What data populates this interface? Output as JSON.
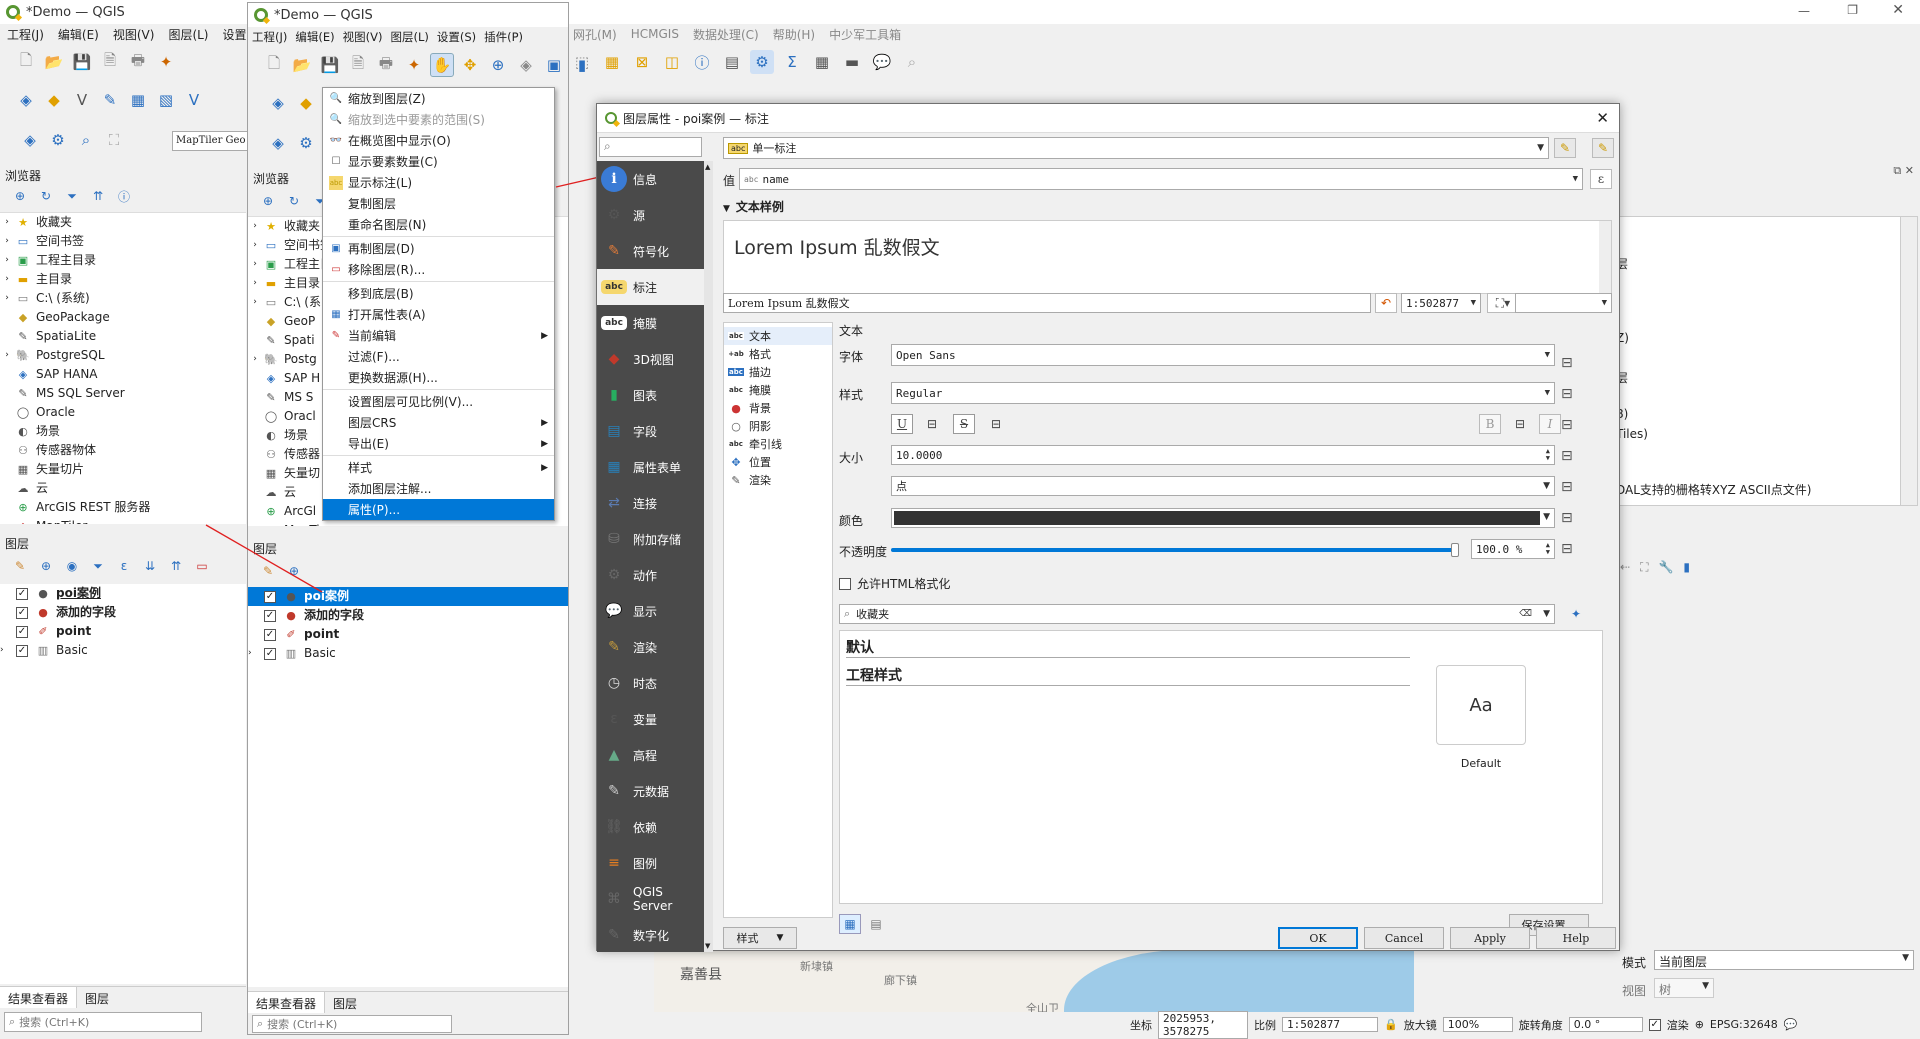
{
  "back_window": {
    "title": "*Demo — QGIS",
    "menu": [
      "工程(J)",
      "编辑(E)",
      "视图(V)",
      "图层(L)",
      "设置"
    ],
    "menu_rest": [
      "网孔(M)",
      "HCMGIS",
      "数据处理(C)",
      "帮助(H)",
      "中少军工具箱"
    ],
    "browser_title": "浏览器",
    "browser_items": [
      "收藏夹",
      "空间书签",
      "工程主目录",
      "主目录",
      "C:\\ (系统)",
      "GeoPackage",
      "SpatiaLite",
      "PostgreSQL",
      "SAP HANA",
      "MS SQL Server",
      "Oracle",
      "场景",
      "传感器物体",
      "矢量切片",
      "云",
      "ArcGIS REST 服务器",
      "MapTiler"
    ],
    "layers_title": "图层",
    "layers": [
      "poi案例",
      "添加的字段",
      "point",
      "Basic"
    ],
    "bottom_tabs": [
      "结果查看器",
      "图层"
    ],
    "search_placeholder": "搜索 (Ctrl+K)",
    "maptiler_label": "MapTiler Geo"
  },
  "front_window": {
    "title": "*Demo — QGIS",
    "menu": [
      "工程(J)",
      "编辑(E)",
      "视图(V)",
      "图层(L)",
      "设置(S)",
      "插件(P)"
    ],
    "browser_title": "浏览器",
    "browser_items": [
      "收藏夹",
      "空间书签",
      "工程主目录",
      "主目录",
      "C:\\ (系",
      "GeoP",
      "Spati",
      "Postg",
      "SAP H",
      "MS S",
      "Oracl",
      "场景",
      "传感器",
      "矢量切",
      "云",
      "ArcGl",
      "MapTi"
    ],
    "layers_title": "图层",
    "layers": [
      "poi案例",
      "添加的字段",
      "point",
      "Basic"
    ],
    "bottom_tabs": [
      "结果查看器",
      "图层"
    ],
    "search_placeholder": "搜索 (Ctrl+K)"
  },
  "context_menu": [
    {
      "label": "缩放到图层(Z)",
      "icon": "zoom-layer-icon"
    },
    {
      "label": "缩放到选中要素的范围(S)",
      "icon": "zoom-selection-icon",
      "disabled": true
    },
    {
      "label": "在概览图中显示(O)",
      "icon": "overview-icon"
    },
    {
      "label": "显示要素数量(C)",
      "icon": "checkbox-icon"
    },
    {
      "label": "显示标注(L)",
      "icon": "label-icon"
    },
    {
      "label": "复制图层",
      "icon": ""
    },
    {
      "label": "重命名图层(N)",
      "icon": ""
    },
    {
      "sep": true
    },
    {
      "label": "再制图层(D)",
      "icon": "duplicate-icon"
    },
    {
      "label": "移除图层(R)...",
      "icon": "remove-icon"
    },
    {
      "sep": true
    },
    {
      "label": "移到底层(B)",
      "icon": ""
    },
    {
      "label": "打开属性表(A)",
      "icon": "table-icon"
    },
    {
      "label": "当前编辑",
      "icon": "pencil-icon",
      "submenu": true
    },
    {
      "label": "过滤(F)...",
      "icon": ""
    },
    {
      "label": "更换数据源(H)...",
      "icon": ""
    },
    {
      "sep": true
    },
    {
      "label": "设置图层可见比例(V)...",
      "icon": ""
    },
    {
      "label": "图层CRS",
      "icon": "",
      "submenu": true
    },
    {
      "label": "导出(E)",
      "icon": "",
      "submenu": true
    },
    {
      "sep": true
    },
    {
      "label": "样式",
      "icon": "",
      "submenu": true
    },
    {
      "label": "添加图层注解...",
      "icon": ""
    },
    {
      "label": "属性(P)...",
      "icon": "",
      "selected": true
    }
  ],
  "dialog": {
    "title": "图层属性 - poi案例 — 标注",
    "mode": "单一标注",
    "value_label": "值",
    "value_field": "name",
    "section_title": "文本样例",
    "preview_text": "Lorem Ipsum 乱数假文",
    "preview_input": "Lorem Ipsum 乱数假文",
    "scale": "1:502877",
    "side_items": [
      {
        "label": "信息",
        "icon": "info-icon",
        "color": "#3a7bd5",
        "glyph": "i"
      },
      {
        "label": "源",
        "icon": "source-icon",
        "color": "#555",
        "glyph": "⚙"
      },
      {
        "label": "符号化",
        "icon": "symbology-icon",
        "color": "#e07b39",
        "glyph": "✎"
      },
      {
        "label": "标注",
        "icon": "labels-icon",
        "color": "#f5d76e",
        "glyph": "abc",
        "active": true
      },
      {
        "label": "掩膜",
        "icon": "mask-icon",
        "color": "#555",
        "glyph": "abc"
      },
      {
        "label": "3D视图",
        "icon": "3d-icon",
        "color": "#c0392b",
        "glyph": "◆"
      },
      {
        "label": "图表",
        "icon": "diagram-icon",
        "color": "#27ae60",
        "glyph": "▮"
      },
      {
        "label": "字段",
        "icon": "fields-icon",
        "color": "#2980b9",
        "glyph": "▤"
      },
      {
        "label": "属性表单",
        "icon": "form-icon",
        "color": "#2980b9",
        "glyph": "▦"
      },
      {
        "label": "连接",
        "icon": "join-icon",
        "color": "#5b7bb0",
        "glyph": "⇄"
      },
      {
        "label": "附加存储",
        "icon": "storage-icon",
        "color": "#777",
        "glyph": "⛁"
      },
      {
        "label": "动作",
        "icon": "action-icon",
        "color": "#666",
        "glyph": "⚙"
      },
      {
        "label": "显示",
        "icon": "display-icon",
        "color": "#f1c40f",
        "glyph": "💬"
      },
      {
        "label": "渲染",
        "icon": "render-icon",
        "color": "#c49a3c",
        "glyph": "✎"
      },
      {
        "label": "时态",
        "icon": "temporal-icon",
        "color": "#ddd",
        "glyph": "◷"
      },
      {
        "label": "变量",
        "icon": "variable-icon",
        "color": "#555",
        "glyph": "ε"
      },
      {
        "label": "高程",
        "icon": "elevation-icon",
        "color": "#6a8",
        "glyph": "▲"
      },
      {
        "label": "元数据",
        "icon": "metadata-icon",
        "color": "#ccc",
        "glyph": "✎"
      },
      {
        "label": "依赖",
        "icon": "dependency-icon",
        "color": "#666",
        "glyph": "⛓"
      },
      {
        "label": "图例",
        "icon": "legend-icon",
        "color": "#e67e22",
        "glyph": "≡"
      },
      {
        "label": "QGIS Server",
        "icon": "server-icon",
        "color": "#666",
        "glyph": "⌘"
      },
      {
        "label": "数字化",
        "icon": "digitize-icon",
        "color": "#666",
        "glyph": "✎"
      }
    ],
    "tabs": [
      {
        "label": "文本",
        "glyph": "abc"
      },
      {
        "label": "格式",
        "glyph": "+ab"
      },
      {
        "label": "描边",
        "glyph": "abc"
      },
      {
        "label": "掩膜",
        "glyph": "abc"
      },
      {
        "label": "背景",
        "glyph": "●"
      },
      {
        "label": "阴影",
        "glyph": "○"
      },
      {
        "label": "牵引线",
        "glyph": "abc"
      },
      {
        "label": "位置",
        "glyph": "✥"
      },
      {
        "label": "渲染",
        "glyph": "✎"
      }
    ],
    "text_section": "文本",
    "font_label": "字体",
    "font_value": "Open Sans",
    "style_label": "样式",
    "style_value": "Regular",
    "size_label": "大小",
    "size_value": "10.0000",
    "unit_value": "点",
    "color_label": "颜色",
    "color_value": "#333333",
    "opacity_label": "不透明度",
    "opacity_value": "100.0 %",
    "opacity_fraction": 1.0,
    "allow_html": "允许HTML格式化",
    "lib_search": "收藏夹",
    "lib_groups": [
      "默认",
      "工程样式"
    ],
    "lib_item": "Default",
    "lib_swatch": "Aa",
    "save_settings": "保存设置…",
    "style_button": "样式",
    "ok": "OK",
    "cancel": "Cancel",
    "apply": "Apply",
    "help": "Help"
  },
  "right_area": {
    "items": [
      "层",
      "Z)",
      "层",
      "8)",
      "Tiles)",
      "DAL支持的栅格转XYZ ASCII点文件)"
    ],
    "mode_label": "模式",
    "mode_value": "当前图层",
    "view_label": "视图",
    "view_value": "树"
  },
  "map": {
    "places": [
      "嘉善县",
      "新埭镇",
      "廊下镇",
      "全山卫"
    ]
  },
  "status": {
    "coord_label": "坐标",
    "coord_value": "2025953, 3578275",
    "scale_label": "比例",
    "scale_value": "1:502877",
    "magnifier_label": "放大镜",
    "magnifier_value": "100%",
    "rotation_label": "旋转角度",
    "rotation_value": "0.0 °",
    "render_label": "渲染",
    "crs": "EPSG:32648"
  }
}
